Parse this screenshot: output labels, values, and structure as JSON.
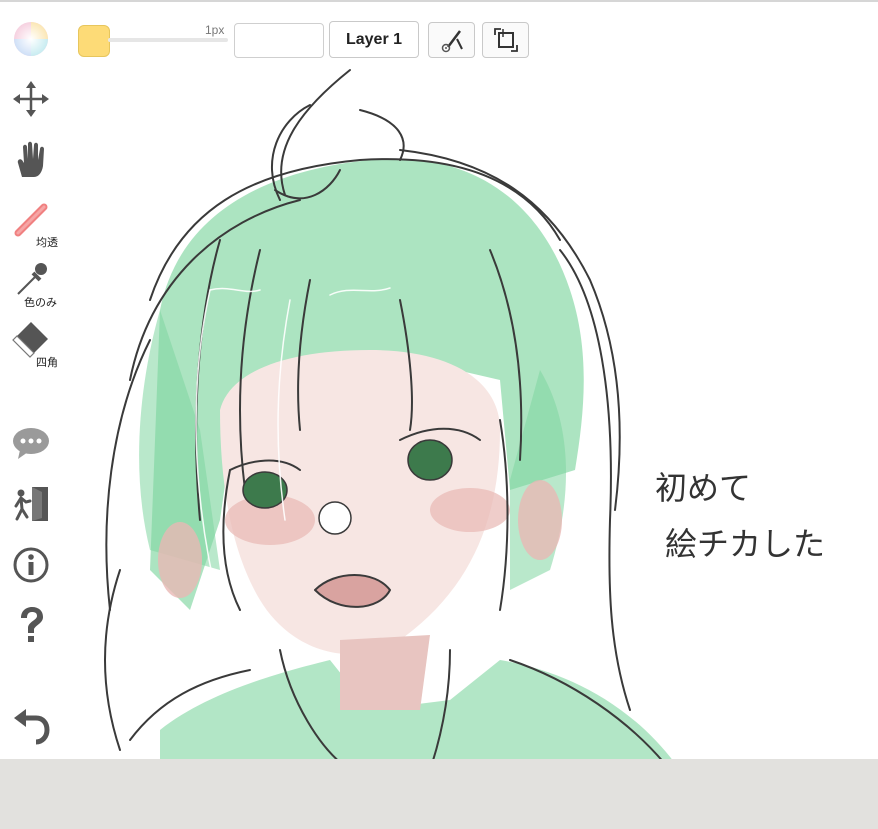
{
  "toolbar": {
    "brush_size_label": "1px",
    "layer_label": "Layer 1",
    "current_color": "#fddb77"
  },
  "tools": {
    "pen_label": "均透",
    "eyedropper_label": "色のみ",
    "eraser_label": "四角"
  },
  "canvas": {
    "handwritten_text_line1": "初めて",
    "handwritten_text_line2": "絵チカした"
  },
  "icons": {
    "color_wheel": "color-wheel-icon",
    "move": "move-arrows-icon",
    "hand": "hand-icon",
    "pen": "pencil-icon",
    "eyedropper": "eyedropper-icon",
    "eraser": "eraser-icon",
    "chat": "chat-bubble-icon",
    "exit": "exit-door-icon",
    "info": "info-icon",
    "help": "question-mark-icon",
    "undo": "undo-icon",
    "pen_settings": "pen-settings-icon",
    "transform": "transform-icon"
  },
  "colors": {
    "hair_green": "#7fd6a0",
    "skin_pink": "#e8b8b4",
    "line_gray": "#3a3a3a"
  }
}
